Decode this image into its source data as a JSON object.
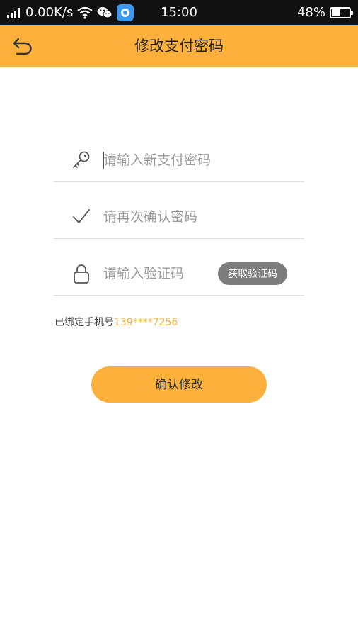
{
  "status_bar": {
    "network_speed": "0.00K/s",
    "time": "15:00",
    "battery_percent": "48%",
    "battery_level": 0.48
  },
  "header": {
    "title": "修改支付密码",
    "accent_color": "#fdb13c"
  },
  "form": {
    "new_password": {
      "placeholder": "请输入新支付密码",
      "value": ""
    },
    "confirm_password": {
      "placeholder": "请再次确认密码",
      "value": ""
    },
    "verification_code": {
      "placeholder": "请输入验证码",
      "value": ""
    },
    "get_code_label": "获取验证码"
  },
  "bound_phone": {
    "label": "已绑定手机号",
    "number": "139****7256"
  },
  "confirm_label": "确认修改",
  "icons": [
    "back-icon",
    "key-icon",
    "check-icon",
    "lock-icon",
    "wifi-icon",
    "wechat-icon",
    "signal-icon",
    "battery-icon"
  ]
}
